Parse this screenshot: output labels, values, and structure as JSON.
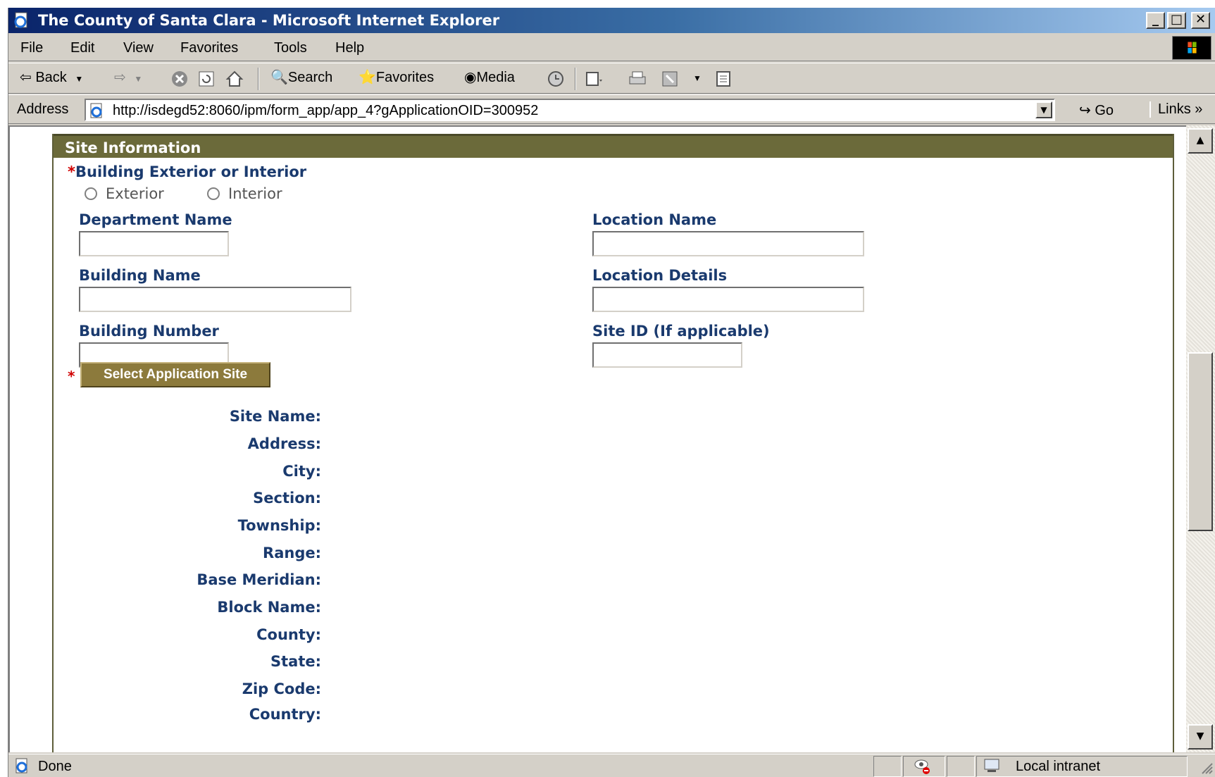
{
  "window": {
    "title": "The County of Santa Clara - Microsoft Internet Explorer",
    "controls": {
      "minimize": "_",
      "maximize": "□",
      "close": "✕"
    }
  },
  "menu": [
    "File",
    "Edit",
    "View",
    "Favorites",
    "Tools",
    "Help"
  ],
  "toolbar": {
    "back": "Back",
    "search": "Search",
    "favorites": "Favorites",
    "media": "Media"
  },
  "address": {
    "label": "Address",
    "url": "http://isdegd52:8060/ipm/form_app/app_4?gApplicationOID=300952",
    "go": "Go",
    "links": "Links"
  },
  "form": {
    "section_title": "Site Information",
    "required_mark": "*",
    "exterior_interior_label": "Building Exterior or Interior",
    "radio_exterior": "Exterior",
    "radio_interior": "Interior",
    "department_name": "Department Name",
    "building_name": "Building Name",
    "building_number": "Building Number",
    "location_name": "Location Name",
    "location_details": "Location Details",
    "site_id": "Site ID (If applicable)",
    "select_site_button": "Select Application Site",
    "site_fields": [
      "Site Name:",
      "Address:",
      "City:",
      "Section:",
      "Township:",
      "Range:",
      "Base Meridian:",
      "Block Name:",
      "County:",
      "State:",
      "Zip Code:",
      "Country:"
    ]
  },
  "status": {
    "text": "Done",
    "zone": "Local intranet"
  }
}
